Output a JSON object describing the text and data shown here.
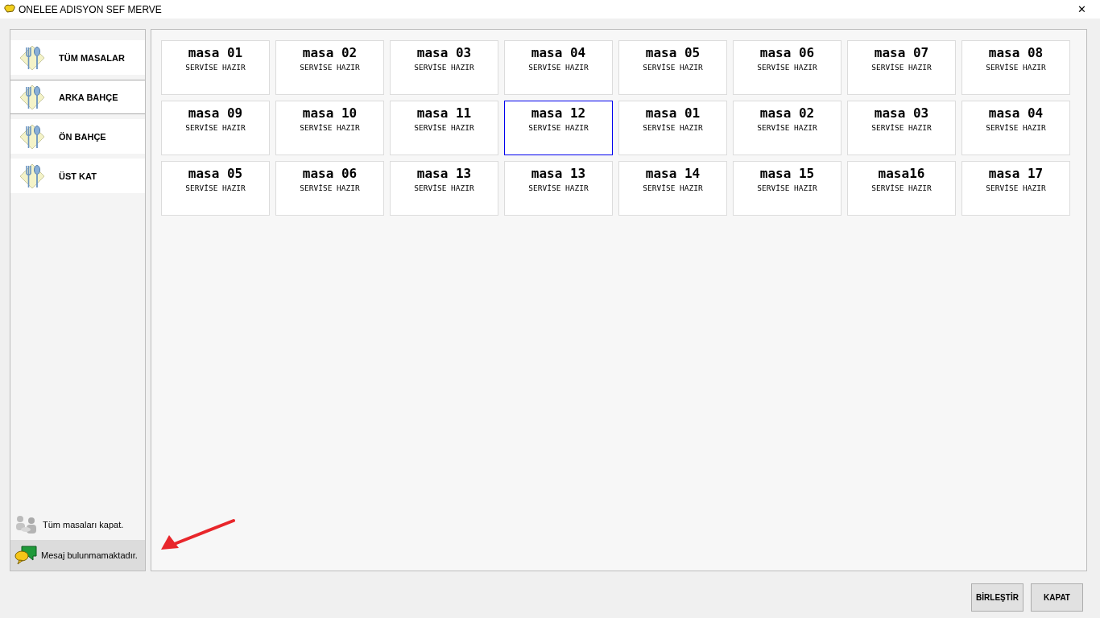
{
  "window": {
    "title": "ONELEE ADISYON SEF MERVE",
    "close": "✕"
  },
  "sidebar": {
    "items": [
      {
        "label": "TÜM MASALAR",
        "selected": false
      },
      {
        "label": "ARKA BAHÇE",
        "selected": true
      },
      {
        "label": "ÖN BAHÇE",
        "selected": false
      },
      {
        "label": "ÜST KAT",
        "selected": false
      }
    ],
    "close_all": "Tüm masaları kapat.",
    "message": "Mesaj bulunmamaktadır."
  },
  "tables": [
    {
      "name": "masa 01",
      "status": "SERVİSE HAZIR",
      "selected": false
    },
    {
      "name": "masa 02",
      "status": "SERVİSE HAZIR",
      "selected": false
    },
    {
      "name": "masa 03",
      "status": "SERVİSE HAZIR",
      "selected": false
    },
    {
      "name": "masa 04",
      "status": "SERVİSE HAZIR",
      "selected": false
    },
    {
      "name": "masa 05",
      "status": "SERVİSE HAZIR",
      "selected": false
    },
    {
      "name": "masa 06",
      "status": "SERVİSE HAZIR",
      "selected": false
    },
    {
      "name": "masa 07",
      "status": "SERVİSE HAZIR",
      "selected": false
    },
    {
      "name": "masa 08",
      "status": "SERVİSE HAZIR",
      "selected": false
    },
    {
      "name": "masa 09",
      "status": "SERVİSE HAZIR",
      "selected": false
    },
    {
      "name": "masa 10",
      "status": "SERVİSE HAZIR",
      "selected": false
    },
    {
      "name": "masa 11",
      "status": "SERVİSE HAZIR",
      "selected": false
    },
    {
      "name": "masa 12",
      "status": "SERVİSE HAZIR",
      "selected": true
    },
    {
      "name": "masa 01",
      "status": "SERVİSE HAZIR",
      "selected": false
    },
    {
      "name": "masa 02",
      "status": "SERVİSE HAZIR",
      "selected": false
    },
    {
      "name": "masa 03",
      "status": "SERVİSE HAZIR",
      "selected": false
    },
    {
      "name": "masa 04",
      "status": "SERVİSE HAZIR",
      "selected": false
    },
    {
      "name": "masa 05",
      "status": "SERVİSE HAZIR",
      "selected": false
    },
    {
      "name": "masa 06",
      "status": "SERVİSE HAZIR",
      "selected": false
    },
    {
      "name": "masa 13",
      "status": "SERVİSE HAZIR",
      "selected": false
    },
    {
      "name": "masa 13",
      "status": "SERVİSE HAZIR",
      "selected": false
    },
    {
      "name": "masa 14",
      "status": "SERVİSE HAZIR",
      "selected": false
    },
    {
      "name": "masa 15",
      "status": "SERVİSE HAZIR",
      "selected": false
    },
    {
      "name": "masa16",
      "status": "SERVİSE HAZIR",
      "selected": false
    },
    {
      "name": "masa 17",
      "status": "SERVİSE HAZIR",
      "selected": false
    }
  ],
  "buttons": [
    "BİRLEŞTİR",
    "KAPAT"
  ]
}
